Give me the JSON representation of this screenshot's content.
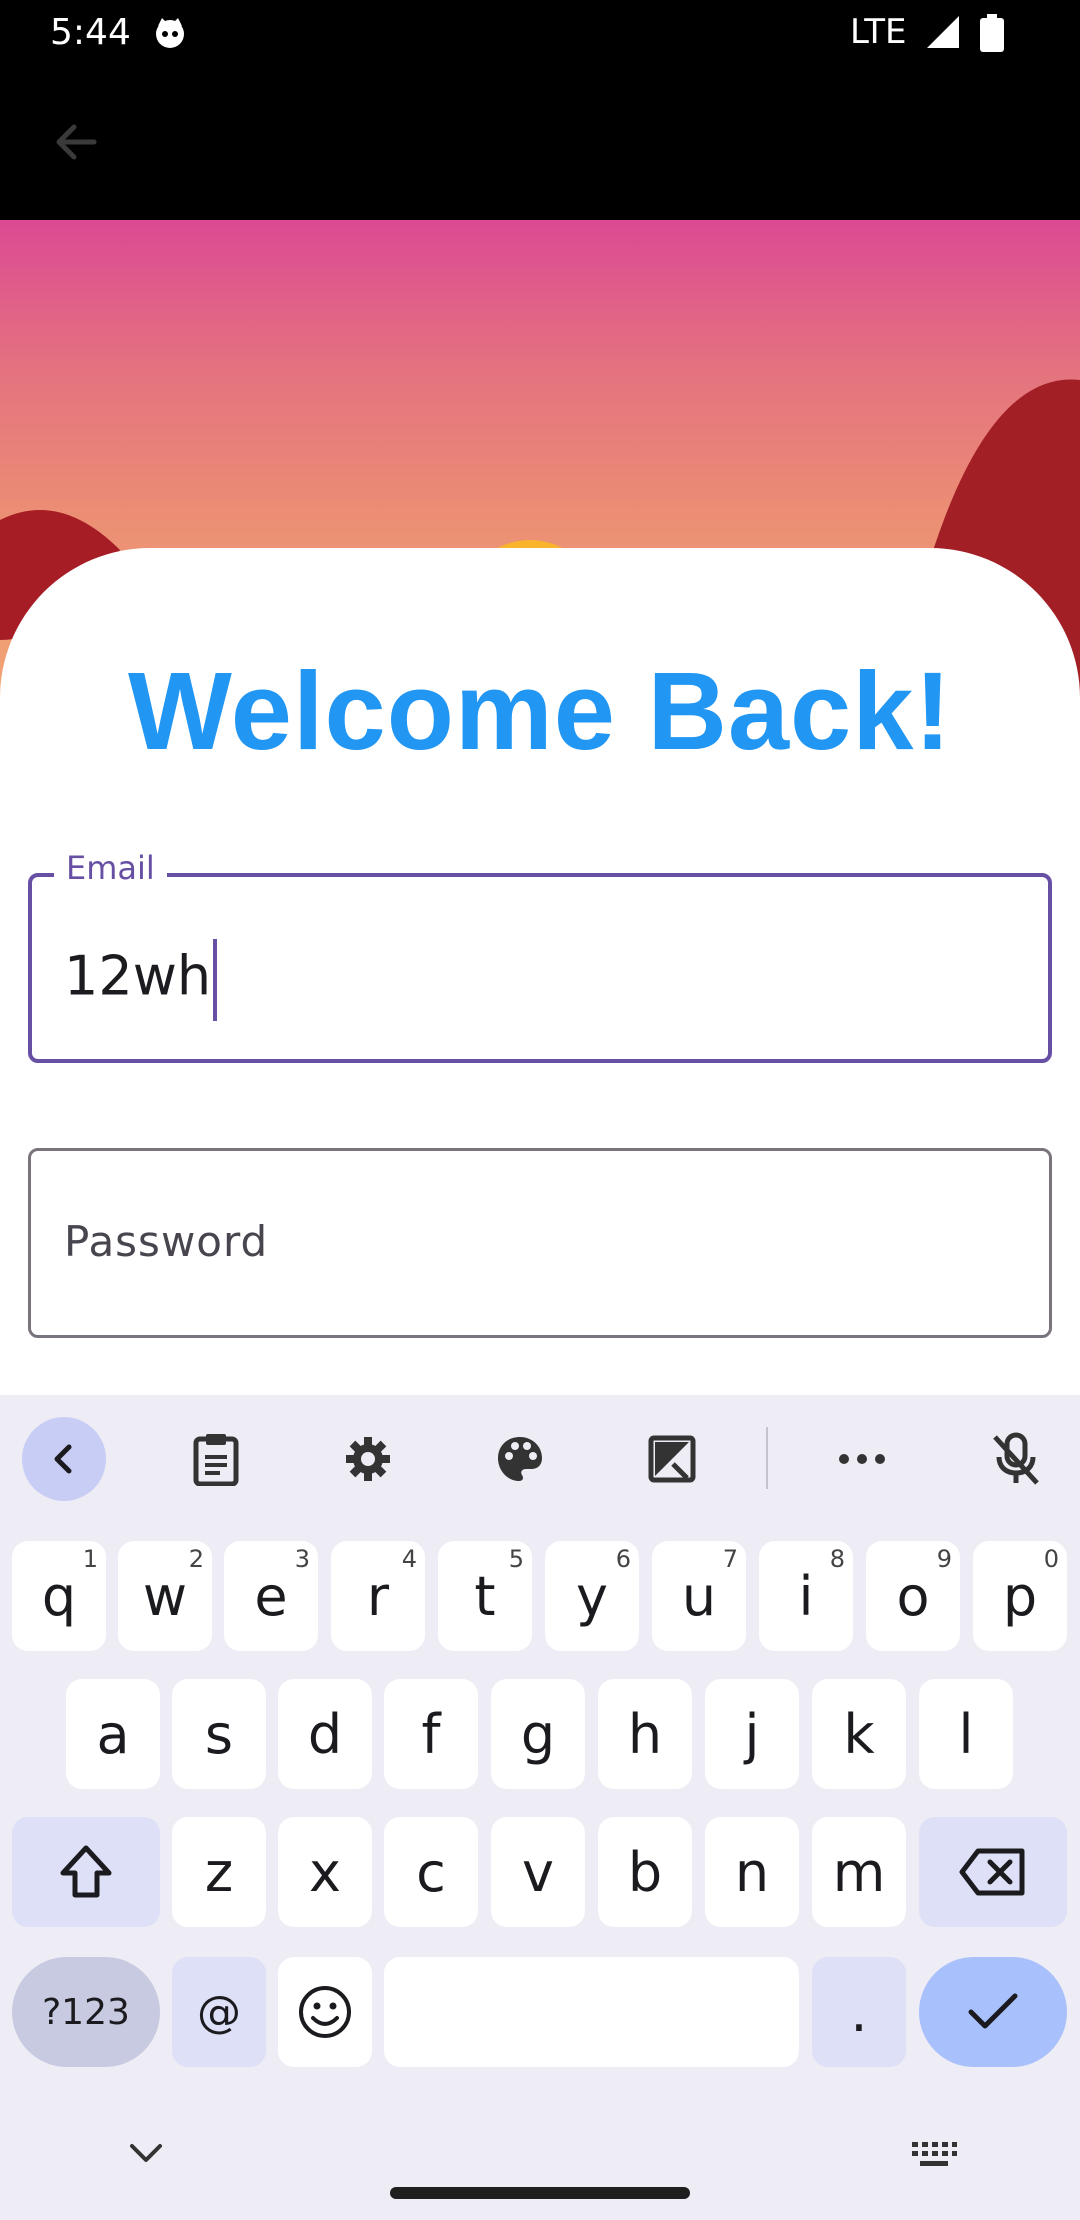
{
  "status_bar": {
    "time": "5:44",
    "network": "LTE"
  },
  "page": {
    "title": "Welcome Back!"
  },
  "email_field": {
    "label": "Email",
    "value": "12wh"
  },
  "password_field": {
    "placeholder": "Password"
  },
  "keyboard": {
    "row1": [
      {
        "key": "q",
        "hint": "1"
      },
      {
        "key": "w",
        "hint": "2"
      },
      {
        "key": "e",
        "hint": "3"
      },
      {
        "key": "r",
        "hint": "4"
      },
      {
        "key": "t",
        "hint": "5"
      },
      {
        "key": "y",
        "hint": "6"
      },
      {
        "key": "u",
        "hint": "7"
      },
      {
        "key": "i",
        "hint": "8"
      },
      {
        "key": "o",
        "hint": "9"
      },
      {
        "key": "p",
        "hint": "0"
      }
    ],
    "row2": [
      "a",
      "s",
      "d",
      "f",
      "g",
      "h",
      "j",
      "k",
      "l"
    ],
    "row3": [
      "z",
      "x",
      "c",
      "v",
      "b",
      "n",
      "m"
    ],
    "row4": {
      "symbols": "?123",
      "at": "@",
      "period": "."
    }
  },
  "colors": {
    "accent": "#2196f3",
    "focus": "#6750a4",
    "keyboard_bg": "#eeedf5"
  }
}
